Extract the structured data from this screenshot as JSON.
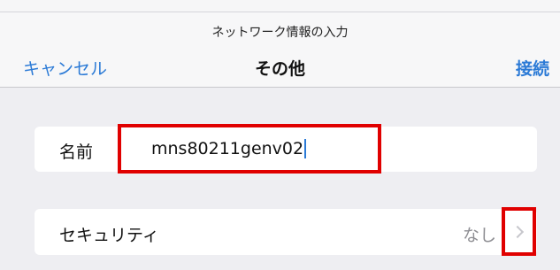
{
  "dialog": {
    "title": "ネットワーク情報の入力"
  },
  "nav": {
    "cancel_label": "キャンセル",
    "title": "その他",
    "connect_label": "接続"
  },
  "form": {
    "name": {
      "label": "名前",
      "value": "mns80211genv02"
    },
    "security": {
      "label": "セキュリティ",
      "value": "なし"
    }
  },
  "colors": {
    "accent": "#2b7ad6",
    "highlight": "#e00000",
    "background": "#eeeef2"
  },
  "icons": {
    "disclosure": "chevron-right-icon"
  }
}
